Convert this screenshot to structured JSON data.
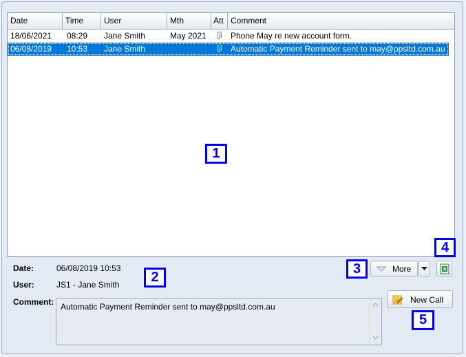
{
  "grid": {
    "columns": [
      "Date",
      "Time",
      "User",
      "Mth",
      "Att",
      "Comment"
    ],
    "rows": [
      {
        "date": "18/06/2021",
        "time": "08:29",
        "user": "Jane Smith",
        "mth": "May 2021",
        "att": "paperclip-icon",
        "comment": "Phone May re new account form.",
        "selected": false
      },
      {
        "date": "06/08/2019",
        "time": "10:53",
        "user": "Jane Smith",
        "mth": "",
        "att": "paperclip-icon",
        "comment": "Automatic Payment Reminder sent to may@ppsltd.com.au",
        "selected": true
      }
    ]
  },
  "detail": {
    "date_label": "Date:",
    "date_value": "06/08/2019 10:53",
    "user_label": "User:",
    "user_value": "JS1 - Jane Smith",
    "comment_label": "Comment:",
    "comment_value": "Automatic Payment Reminder sent to may@ppsltd.com.au"
  },
  "buttons": {
    "more_label": "More",
    "new_call_label": "New Call"
  },
  "annotations": [
    "1",
    "2",
    "3",
    "4",
    "5"
  ],
  "colors": {
    "selection": "#0078d7",
    "annotation": "#0000ee",
    "excel_green": "#1f8a3a"
  }
}
